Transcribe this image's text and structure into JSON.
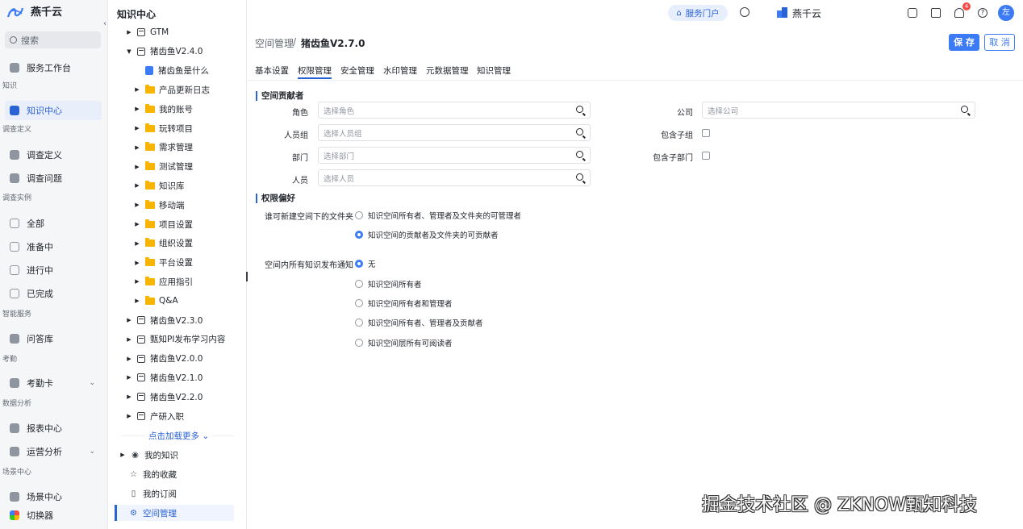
{
  "app": {
    "name": "燕千云"
  },
  "leftnav": {
    "search_placeholder": "搜索",
    "items": [
      {
        "type": "item",
        "label": "服务工作台",
        "icon": "desk-icon"
      },
      {
        "type": "section",
        "label": "知识"
      },
      {
        "type": "item",
        "label": "知识中心",
        "icon": "book-icon",
        "active": true
      },
      {
        "type": "section",
        "label": "调查定义"
      },
      {
        "type": "item",
        "label": "调查定义",
        "icon": "survey-icon"
      },
      {
        "type": "item",
        "label": "调查问题",
        "icon": "question-icon"
      },
      {
        "type": "section",
        "label": "调查实例"
      },
      {
        "type": "item",
        "label": "全部",
        "icon": "grid-icon"
      },
      {
        "type": "item",
        "label": "准备中",
        "icon": "calendar-icon"
      },
      {
        "type": "item",
        "label": "进行中",
        "icon": "hourglass-icon"
      },
      {
        "type": "item",
        "label": "已完成",
        "icon": "doc-icon"
      },
      {
        "type": "section",
        "label": "智能服务"
      },
      {
        "type": "item",
        "label": "问答库",
        "icon": "qa-icon"
      },
      {
        "type": "section",
        "label": "考勤"
      },
      {
        "type": "item",
        "label": "考勤卡",
        "icon": "card-icon",
        "chevron": true
      },
      {
        "type": "section",
        "label": "数据分析"
      },
      {
        "type": "item",
        "label": "报表中心",
        "icon": "bar-chart-icon"
      },
      {
        "type": "item",
        "label": "运营分析",
        "icon": "analysis-icon",
        "chevron": true
      },
      {
        "type": "section",
        "label": "场景中心"
      },
      {
        "type": "item",
        "label": "场景中心",
        "icon": "scene-icon"
      },
      {
        "type": "item",
        "label": "切换器",
        "icon": "switcher-icon"
      }
    ]
  },
  "tree": {
    "title": "知识中心",
    "nodes": [
      {
        "label": "GTM",
        "kind": "book",
        "indent": 1,
        "arrow": "right"
      },
      {
        "label": "猪齿鱼V2.4.0",
        "kind": "book",
        "indent": 1,
        "arrow": "down"
      },
      {
        "label": "猪齿鱼是什么",
        "kind": "doc",
        "indent": 2,
        "arrow": ""
      },
      {
        "label": "产品更新日志",
        "kind": "folder",
        "indent": 2,
        "arrow": "right"
      },
      {
        "label": "我的账号",
        "kind": "folder",
        "indent": 2,
        "arrow": "right"
      },
      {
        "label": "玩转项目",
        "kind": "folder",
        "indent": 2,
        "arrow": "right"
      },
      {
        "label": "需求管理",
        "kind": "folder",
        "indent": 2,
        "arrow": "right"
      },
      {
        "label": "测试管理",
        "kind": "folder",
        "indent": 2,
        "arrow": "right"
      },
      {
        "label": "知识库",
        "kind": "folder",
        "indent": 2,
        "arrow": "right"
      },
      {
        "label": "移动端",
        "kind": "folder",
        "indent": 2,
        "arrow": "right"
      },
      {
        "label": "项目设置",
        "kind": "folder",
        "indent": 2,
        "arrow": "right"
      },
      {
        "label": "组织设置",
        "kind": "folder",
        "indent": 2,
        "arrow": "right"
      },
      {
        "label": "平台设置",
        "kind": "folder",
        "indent": 2,
        "arrow": "right"
      },
      {
        "label": "应用指引",
        "kind": "folder",
        "indent": 2,
        "arrow": "right"
      },
      {
        "label": "Q&A",
        "kind": "folder",
        "indent": 2,
        "arrow": "right"
      },
      {
        "label": "猪齿鱼V2.3.0",
        "kind": "book",
        "indent": 1,
        "arrow": "right"
      },
      {
        "label": "甄知PI发布学习内容",
        "kind": "book",
        "indent": 1,
        "arrow": "right"
      },
      {
        "label": "猪齿鱼V2.0.0",
        "kind": "book",
        "indent": 1,
        "arrow": "right"
      },
      {
        "label": "猪齿鱼V2.1.0",
        "kind": "book",
        "indent": 1,
        "arrow": "right"
      },
      {
        "label": "猪齿鱼V2.2.0",
        "kind": "book",
        "indent": 1,
        "arrow": "right"
      },
      {
        "label": "产研入职",
        "kind": "book",
        "indent": 1,
        "arrow": "right"
      }
    ],
    "load_more": "点击加载更多 ⌄",
    "bottom": [
      {
        "label": "我的知识",
        "icon": "my-knowledge-icon",
        "arrow": "right"
      },
      {
        "label": "我的收藏",
        "icon": "star-icon"
      },
      {
        "label": "我的订阅",
        "icon": "bookmark-icon"
      },
      {
        "label": "空间管理",
        "icon": "gear-icon",
        "active": true
      }
    ]
  },
  "topbar": {
    "portal": "服务门户",
    "brand": "燕千云",
    "notification_count": "4",
    "avatar": "左"
  },
  "main": {
    "breadcrumb": [
      "空间管理",
      "/",
      "猪齿鱼V2.7.0"
    ],
    "save": "保 存",
    "cancel": "取 消",
    "tabs": [
      "基本设置",
      "权限管理",
      "安全管理",
      "水印管理",
      "元数据管理",
      "知识管理"
    ],
    "active_tab": 1,
    "contributors": {
      "title": "空间贡献者",
      "left_fields": [
        {
          "label": "角色",
          "placeholder": "选择角色"
        },
        {
          "label": "人员组",
          "placeholder": "选择人员组"
        },
        {
          "label": "部门",
          "placeholder": "选择部门"
        },
        {
          "label": "人员",
          "placeholder": "选择人员"
        }
      ],
      "company": {
        "label": "公司",
        "placeholder": "选择公司"
      },
      "checks": [
        {
          "label": "包含子组",
          "checked": false
        },
        {
          "label": "包含子部门",
          "checked": false
        }
      ]
    },
    "prefs": {
      "title": "权限偏好",
      "q1": {
        "label": "谁可新建空间下的文件夹",
        "options": [
          "知识空间所有者、管理者及文件夹的可管理者",
          "知识空间的贡献者及文件夹的可贡献者"
        ],
        "selected": 1
      },
      "q2": {
        "label": "空间内所有知识发布通知",
        "options": [
          "无",
          "知识空间所有者",
          "知识空间所有者和管理者",
          "知识空间所有者、管理者及贡献者",
          "知识空间层所有可阅读者"
        ],
        "selected": 0
      }
    }
  },
  "watermark": "掘金技术社区 @ ZKNOW甄知科技"
}
